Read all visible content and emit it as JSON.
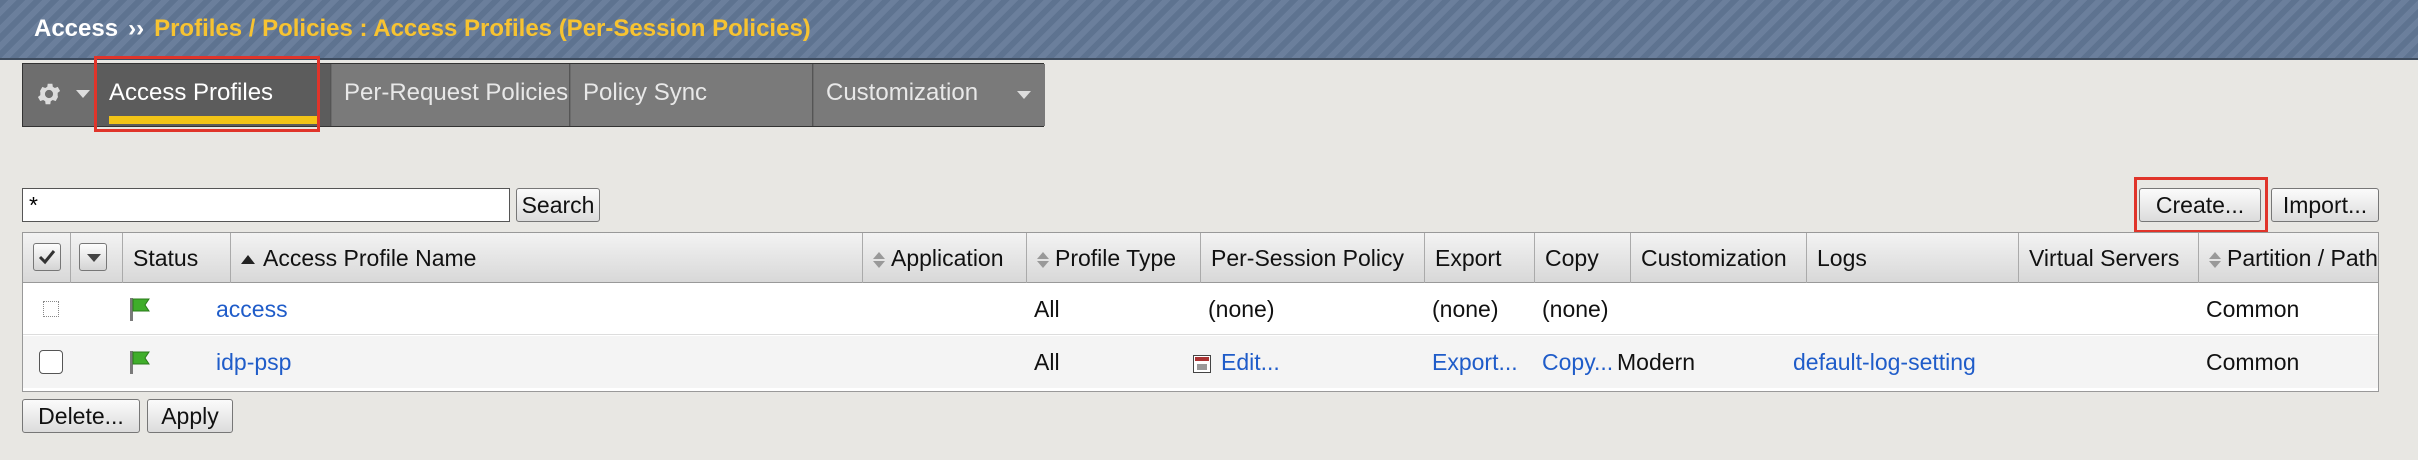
{
  "breadcrumb": {
    "root": "Access",
    "separator": "››",
    "path": "Profiles / Policies : Access Profiles (Per-Session Policies)"
  },
  "tabs": {
    "gear_icon": "gear-icon",
    "items": [
      {
        "label": "Access Profiles",
        "active": true
      },
      {
        "label": "Per-Request Policies",
        "active": false
      },
      {
        "label": "Policy Sync",
        "active": false
      },
      {
        "label": "Customization",
        "active": false,
        "has_dropdown": true
      }
    ]
  },
  "filter": {
    "value": "*",
    "search_label": "Search"
  },
  "actions": {
    "create_label": "Create...",
    "import_label": "Import...",
    "delete_label": "Delete...",
    "apply_label": "Apply"
  },
  "table": {
    "columns": {
      "status": "Status",
      "name": "Access Profile Name",
      "application": "Application",
      "profile_type": "Profile Type",
      "per_session_policy": "Per-Session Policy",
      "export": "Export",
      "copy": "Copy",
      "customization": "Customization",
      "logs": "Logs",
      "virtual_servers": "Virtual Servers",
      "partition": "Partition / Path"
    },
    "rows": [
      {
        "status_icon": "green-flag-icon",
        "name": "access",
        "application": "",
        "profile_type": "All",
        "per_session_policy": "(none)",
        "export": "(none)",
        "copy": "(none)",
        "customization": "",
        "logs": "",
        "virtual_servers": "",
        "partition": "Common"
      },
      {
        "status_icon": "green-flag-icon",
        "name": "idp-psp",
        "application": "",
        "profile_type": "All",
        "per_session_policy": "Edit...",
        "export": "Export...",
        "copy": "Copy...",
        "customization": "Modern",
        "logs": "default-log-setting",
        "virtual_servers": "",
        "partition": "Common"
      }
    ]
  },
  "colors": {
    "accent_yellow": "#f7c331",
    "highlight_red": "#e0342a",
    "link_blue": "#1f5cc9"
  }
}
